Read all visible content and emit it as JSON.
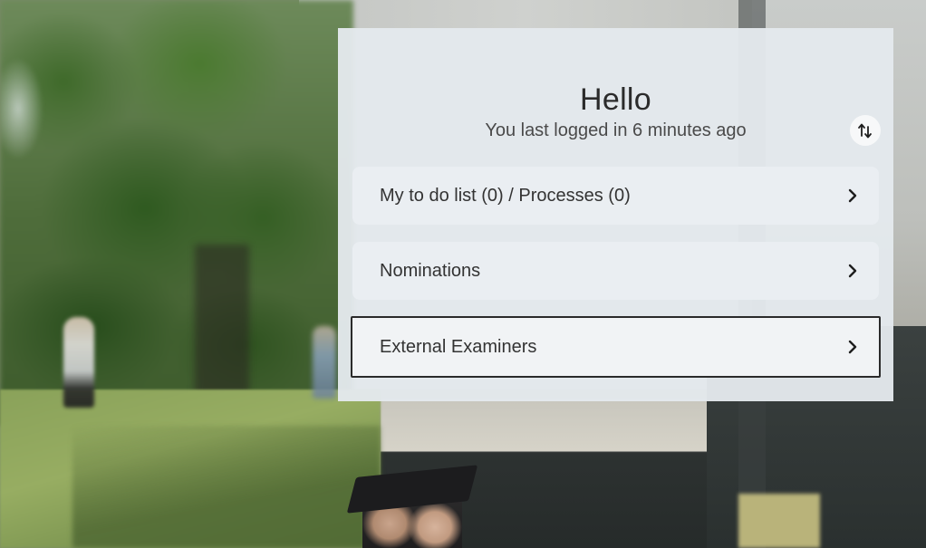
{
  "card": {
    "title": "Hello",
    "subtitle": "You last logged in 6 minutes ago",
    "sort_icon": "sort-arrows-icon",
    "items": [
      {
        "label": "My to do list (0) / Processes (0)",
        "icon": "chevron-right-icon"
      },
      {
        "label": "Nominations",
        "icon": "chevron-right-icon"
      },
      {
        "label": "External Examiners",
        "icon": "chevron-right-icon",
        "focused": true
      }
    ]
  },
  "colors": {
    "card_background": "#e4e9ed",
    "text": "#333333",
    "focus_border": "#2a2a2a"
  }
}
